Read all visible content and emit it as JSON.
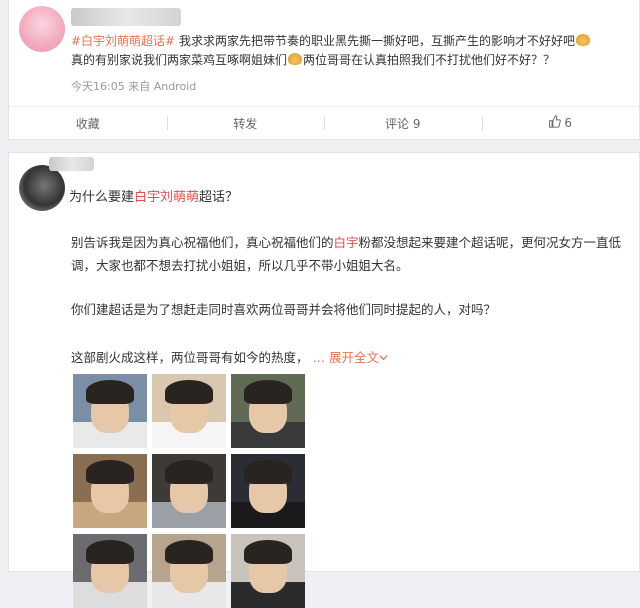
{
  "post1": {
    "topic_tag": "#白宇刘萌萌超话#",
    "text_a": " 我求求两家先把带节奏的职业黑先撕一撕好吧，互撕产生的影响才不好好吧",
    "text_b": "真的有别家说我们两家菜鸡互啄啊姐妹们",
    "text_c": "两位哥哥在认真拍照我们不打扰他们好不好？？",
    "meta": "今天16:05 来自 Android",
    "actions": {
      "collect": "收藏",
      "repost": "转发",
      "comment": "评论 9",
      "like_count": "6"
    }
  },
  "post2": {
    "question_a": "为什么要建",
    "question_name": "白宇刘萌萌",
    "question_b": "超话？",
    "para1_a": "别告诉我是因为真心祝福他们，真心祝福他们的",
    "para1_name": "白宇",
    "para1_b": "粉都没想起来要建个超话呢，更何况女方一直低调，大家也都不想去打扰小姐姐，所以几乎不带小姐姐大名。",
    "para2": "你们建超话是为了想赶走同时喜欢两位哥哥并会将他们同时提起的人，对吗？",
    "para3": "这部剧火成这样，两位哥哥有如今的热度，",
    "expand": "展开全文",
    "photos": [
      {
        "bg": "#7a8fa6",
        "shirt": "#e9e9e9"
      },
      {
        "bg": "#d9c7b0",
        "shirt": "#f5f5f5"
      },
      {
        "bg": "#5f6b55",
        "shirt": "#3a3a3a"
      },
      {
        "bg": "#8a6e52",
        "shirt": "#c9a77e"
      },
      {
        "bg": "#3e3a37",
        "shirt": "#9aa0a6"
      },
      {
        "bg": "#2a2d33",
        "shirt": "#1a1a1a"
      },
      {
        "bg": "#6b6b70",
        "shirt": "#ddd"
      },
      {
        "bg": "#b7a48f",
        "shirt": "#e8e8e8"
      },
      {
        "bg": "#c9c3bd",
        "shirt": "#2b2b2b"
      }
    ]
  }
}
